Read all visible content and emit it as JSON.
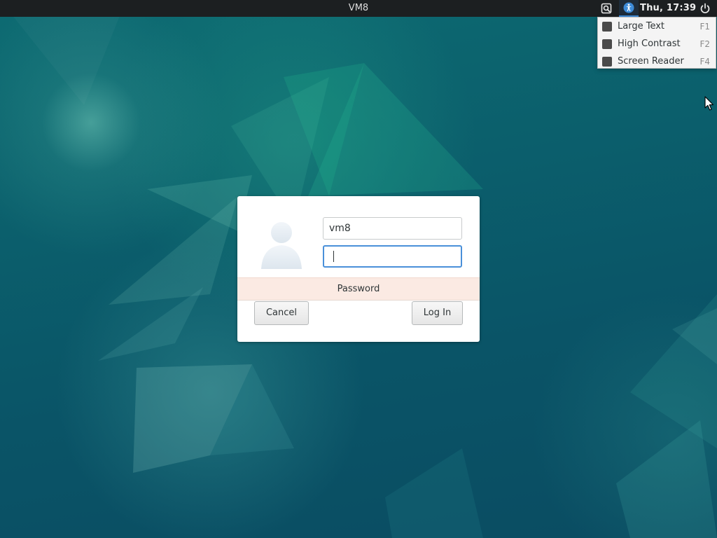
{
  "topbar": {
    "host": "VM8",
    "clock": "Thu, 17:39",
    "icons": [
      "keyboard-layout-icon",
      "accessibility-icon",
      "power-icon"
    ]
  },
  "accessibility_menu": {
    "items": [
      {
        "label": "Large Text",
        "shortcut": "F1",
        "checked": false
      },
      {
        "label": "High Contrast",
        "shortcut": "F2",
        "checked": false
      },
      {
        "label": "Screen Reader",
        "shortcut": "F4",
        "checked": false
      }
    ]
  },
  "login": {
    "username": "vm8",
    "password_value": "",
    "prompt": "Password",
    "cancel_label": "Cancel",
    "login_label": "Log In"
  },
  "colors": {
    "topbar_bg": "#1c1f21",
    "accent": "#4a90d9",
    "prompt_bg": "#fbeae3",
    "wallpaper": "#0b5f6c"
  }
}
